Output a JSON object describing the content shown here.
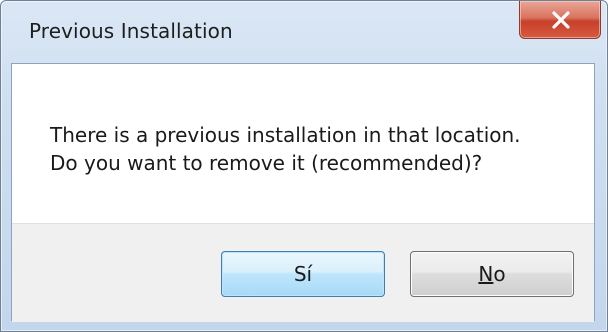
{
  "window": {
    "title": "Previous Installation",
    "close_icon": "close-icon"
  },
  "message": {
    "line1": "There is a previous installation in that location.",
    "line2": "Do you want to remove it (recommended)?"
  },
  "buttons": {
    "yes_label": "Sí",
    "no_mnemonic": "N",
    "no_rest": "o"
  },
  "colors": {
    "close_button": "#c8402a",
    "default_button_border": "#3c7fb1",
    "button_area": "#f0f0f0"
  }
}
